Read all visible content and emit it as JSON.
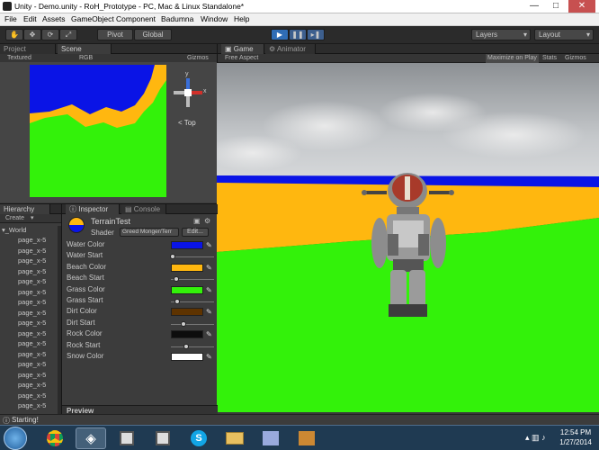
{
  "window": {
    "title": "Unity - Demo.unity - RoH_Prototype - PC, Mac & Linux Standalone*",
    "minimize": "—",
    "maximize": "□",
    "close": "✕"
  },
  "menu": [
    "File",
    "Edit",
    "Assets",
    "GameObject",
    "Component",
    "Badumna",
    "Window",
    "Help"
  ],
  "toolbar": {
    "pivot": "Pivot",
    "global": "Global",
    "layers": "Layers",
    "layout": "Layout",
    "play_icon": "play-icon",
    "pause_icon": "pause-icon",
    "step_icon": "step-icon"
  },
  "scene_panel": {
    "tabs": [
      "Project",
      "Scene"
    ],
    "shading": "Textured",
    "render": "RGB",
    "gizmos": "Gizmos",
    "view_label": "Top",
    "gizmo_y": "y",
    "gizmo_x": "x"
  },
  "game_panel": {
    "tabs": [
      "Game",
      "Animator"
    ],
    "aspect": "Free Aspect",
    "maximize": "Maximize on Play",
    "stats": "Stats",
    "gizmos": "Gizmos"
  },
  "hierarchy": {
    "tab": "Hierarchy",
    "create": "Create",
    "root": "_World",
    "items": [
      "page_x-5",
      "page_x-5",
      "page_x-5",
      "page_x-5",
      "page_x-5",
      "page_x-5",
      "page_x-5",
      "page_x-5",
      "page_x-5",
      "page_x-5",
      "page_x-5",
      "page_x-5",
      "page_x-5",
      "page_x-5",
      "page_x-5",
      "page_x-5",
      "page_x-5",
      "page_x-5",
      "page_x-5"
    ]
  },
  "inspector": {
    "tabs": [
      "Inspector",
      "Console"
    ],
    "material_name": "TerrainTest",
    "shader_label": "Shader",
    "shader_value": "Greed Monger/Terr",
    "edit_button": "Edit...",
    "properties": [
      {
        "label": "Water Color",
        "kind": "color",
        "color": "#0a14e6"
      },
      {
        "label": "Water Start",
        "kind": "slider",
        "value": 0.05
      },
      {
        "label": "Beach Color",
        "kind": "color",
        "color": "#ffb70f"
      },
      {
        "label": "Beach Start",
        "kind": "slider",
        "value": 0.12
      },
      {
        "label": "Grass Color",
        "kind": "color",
        "color": "#33f20a"
      },
      {
        "label": "Grass Start",
        "kind": "slider",
        "value": 0.15
      },
      {
        "label": "Dirt Color",
        "kind": "color",
        "color": "#5e3300"
      },
      {
        "label": "Dirt Start",
        "kind": "slider",
        "value": 0.3
      },
      {
        "label": "Rock Color",
        "kind": "color",
        "color": "#0d0d0d"
      },
      {
        "label": "Rock Start",
        "kind": "slider",
        "value": 0.35
      },
      {
        "label": "Snow Color",
        "kind": "color",
        "color": "#ffffff"
      }
    ],
    "preview": "Preview"
  },
  "status": {
    "message": "Starting!"
  },
  "taskbar": {
    "time": "12:54 PM",
    "date": "1/27/2014"
  }
}
